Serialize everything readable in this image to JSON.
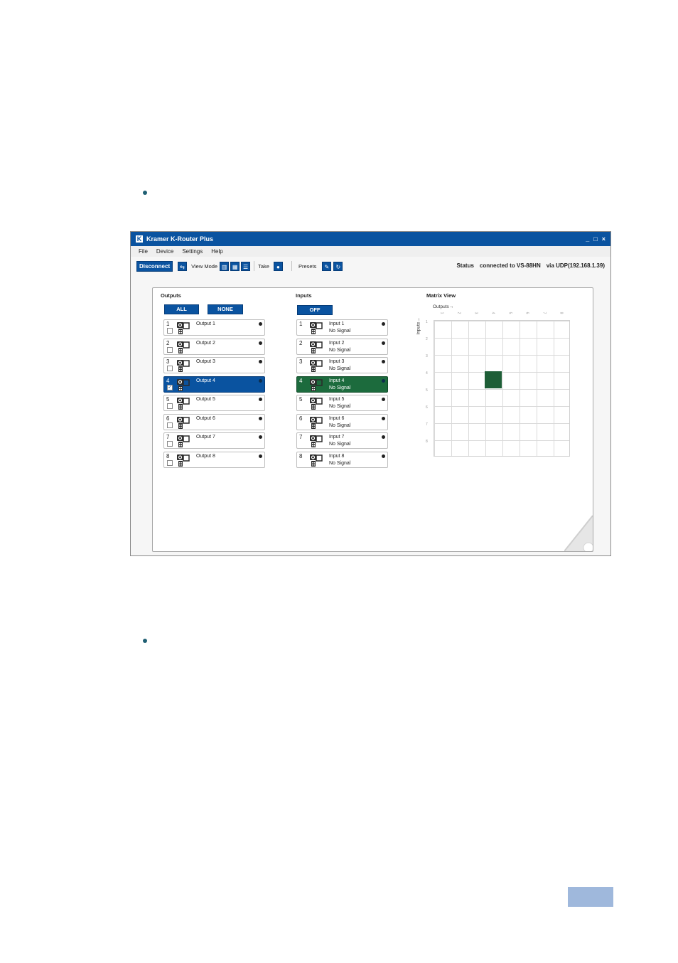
{
  "window": {
    "title": "Kramer K-Router Plus",
    "controls": [
      "_",
      "□",
      "×"
    ]
  },
  "menu": [
    "File",
    "Device",
    "Settings",
    "Help"
  ],
  "toolbar": {
    "disconnect": "Disconnect",
    "view_mode": "View Mode",
    "take": "Take",
    "presets": "Presets",
    "status_label": "Status",
    "status_device": "connected to VS-88HN",
    "status_via": "via UDP(192.168.1.39)"
  },
  "outputs": {
    "title": "Outputs",
    "all": "ALL",
    "none": "NONE",
    "items": [
      {
        "num": "1",
        "name": "Output 1",
        "checked": ""
      },
      {
        "num": "2",
        "name": "Output 2",
        "checked": ""
      },
      {
        "num": "3",
        "name": "Output 3",
        "checked": ""
      },
      {
        "num": "4",
        "name": "Output 4",
        "checked": "✓"
      },
      {
        "num": "5",
        "name": "Output 5",
        "checked": ""
      },
      {
        "num": "6",
        "name": "Output 6",
        "checked": ""
      },
      {
        "num": "7",
        "name": "Output 7",
        "checked": ""
      },
      {
        "num": "8",
        "name": "Output 8",
        "checked": ""
      }
    ]
  },
  "inputs": {
    "title": "Inputs",
    "off": "OFF",
    "items": [
      {
        "num": "1",
        "name": "Input 1",
        "signal": "No Signal"
      },
      {
        "num": "2",
        "name": "Input 2",
        "signal": "No Signal"
      },
      {
        "num": "3",
        "name": "Input 3",
        "signal": "No Signal"
      },
      {
        "num": "4",
        "name": "Input 4",
        "signal": "No Signal"
      },
      {
        "num": "5",
        "name": "Input 5",
        "signal": "No Signal"
      },
      {
        "num": "6",
        "name": "Input 6",
        "signal": "No Signal"
      },
      {
        "num": "7",
        "name": "Input 7",
        "signal": "No Signal"
      },
      {
        "num": "8",
        "name": "Input 8",
        "signal": "No Signal"
      }
    ]
  },
  "matrix": {
    "title": "Matrix View",
    "outputs_label": "Outputs",
    "inputs_label": "Inputs",
    "col_ticks": [
      "1",
      "2",
      "3",
      "4",
      "5",
      "6",
      "7",
      "8"
    ],
    "row_ticks": [
      "1",
      "2",
      "3",
      "4",
      "5",
      "6",
      "7",
      "8"
    ],
    "active_input": 4,
    "active_output": 4
  },
  "colors": {
    "brand": "#0a53a0",
    "route": "#1e5e37"
  }
}
